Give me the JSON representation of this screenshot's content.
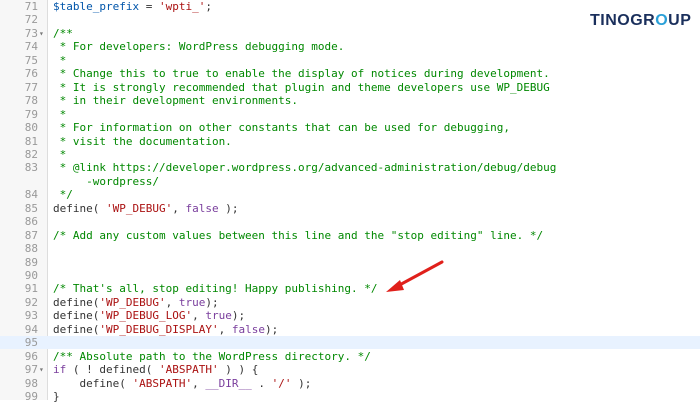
{
  "logo": {
    "text_a": "TINO",
    "text_b": "GR",
    "text_o": "O",
    "text_c": "UP"
  },
  "colors": {
    "comment": "#008800",
    "string": "#aa1111",
    "keyword": "#7a3e9d",
    "arrow": "#e0201b"
  },
  "lines": [
    {
      "n": "71",
      "fold": "",
      "parts": [
        [
          "v",
          "$table_prefix"
        ],
        [
          "f",
          " = "
        ],
        [
          "s",
          "'wpti_'"
        ],
        [
          "f",
          ";"
        ]
      ]
    },
    {
      "n": "72",
      "fold": "",
      "parts": []
    },
    {
      "n": "73",
      "fold": "▾",
      "parts": [
        [
          "c",
          "/**"
        ]
      ]
    },
    {
      "n": "74",
      "fold": "",
      "parts": [
        [
          "c",
          " * For developers: WordPress debugging mode."
        ]
      ]
    },
    {
      "n": "75",
      "fold": "",
      "parts": [
        [
          "c",
          " *"
        ]
      ]
    },
    {
      "n": "76",
      "fold": "",
      "parts": [
        [
          "c",
          " * Change this to true to enable the display of notices during development."
        ]
      ]
    },
    {
      "n": "77",
      "fold": "",
      "parts": [
        [
          "c",
          " * It is strongly recommended that plugin and theme developers use WP_DEBUG"
        ]
      ]
    },
    {
      "n": "78",
      "fold": "",
      "parts": [
        [
          "c",
          " * in their development environments."
        ]
      ]
    },
    {
      "n": "79",
      "fold": "",
      "parts": [
        [
          "c",
          " *"
        ]
      ]
    },
    {
      "n": "80",
      "fold": "",
      "parts": [
        [
          "c",
          " * For information on other constants that can be used for debugging,"
        ]
      ]
    },
    {
      "n": "81",
      "fold": "",
      "parts": [
        [
          "c",
          " * visit the documentation."
        ]
      ]
    },
    {
      "n": "82",
      "fold": "",
      "parts": [
        [
          "c",
          " *"
        ]
      ]
    },
    {
      "n": "83",
      "fold": "",
      "parts": [
        [
          "c",
          " * @link https://developer.wordpress.org/advanced-administration/debug/debug"
        ]
      ]
    },
    {
      "n": "",
      "fold": "",
      "parts": [
        [
          "c",
          "     -wordpress/"
        ]
      ]
    },
    {
      "n": "84",
      "fold": "",
      "parts": [
        [
          "c",
          " */"
        ]
      ]
    },
    {
      "n": "85",
      "fold": "",
      "parts": [
        [
          "f",
          "define( "
        ],
        [
          "s",
          "'WP_DEBUG'"
        ],
        [
          "f",
          ", "
        ],
        [
          "k",
          "false"
        ],
        [
          "f",
          " );"
        ]
      ]
    },
    {
      "n": "86",
      "fold": "",
      "parts": []
    },
    {
      "n": "87",
      "fold": "",
      "parts": [
        [
          "c",
          "/* Add any custom values between this line and the \"stop editing\" line. */"
        ]
      ]
    },
    {
      "n": "88",
      "fold": "",
      "parts": []
    },
    {
      "n": "89",
      "fold": "",
      "parts": []
    },
    {
      "n": "90",
      "fold": "",
      "parts": []
    },
    {
      "n": "91",
      "fold": "",
      "parts": [
        [
          "c",
          "/* That's all, stop editing! Happy publishing. */"
        ]
      ]
    },
    {
      "n": "92",
      "fold": "",
      "parts": [
        [
          "f",
          "define("
        ],
        [
          "s",
          "'WP_DEBUG'"
        ],
        [
          "f",
          ", "
        ],
        [
          "k",
          "true"
        ],
        [
          "f",
          ");"
        ]
      ]
    },
    {
      "n": "93",
      "fold": "",
      "parts": [
        [
          "f",
          "define("
        ],
        [
          "s",
          "'WP_DEBUG_LOG'"
        ],
        [
          "f",
          ", "
        ],
        [
          "k",
          "true"
        ],
        [
          "f",
          ");"
        ]
      ]
    },
    {
      "n": "94",
      "fold": "",
      "parts": [
        [
          "f",
          "define("
        ],
        [
          "s",
          "'WP_DEBUG_DISPLAY'"
        ],
        [
          "f",
          ", "
        ],
        [
          "k",
          "false"
        ],
        [
          "f",
          ");"
        ]
      ]
    },
    {
      "n": "95",
      "fold": "",
      "parts": [],
      "active": true
    },
    {
      "n": "96",
      "fold": "",
      "parts": [
        [
          "c",
          "/** Absolute path to the WordPress directory. */"
        ]
      ]
    },
    {
      "n": "97",
      "fold": "▾",
      "parts": [
        [
          "k",
          "if"
        ],
        [
          "f",
          " ( ! defined( "
        ],
        [
          "s",
          "'ABSPATH'"
        ],
        [
          "f",
          " ) ) {"
        ]
      ]
    },
    {
      "n": "98",
      "fold": "",
      "parts": [
        [
          "f",
          "    define( "
        ],
        [
          "s",
          "'ABSPATH'"
        ],
        [
          "f",
          ", "
        ],
        [
          "k",
          "__DIR__"
        ],
        [
          "f",
          " . "
        ],
        [
          "s",
          "'/'"
        ],
        [
          "f",
          " );"
        ]
      ]
    },
    {
      "n": "99",
      "fold": "",
      "parts": [
        [
          "f",
          "}"
        ]
      ]
    }
  ]
}
